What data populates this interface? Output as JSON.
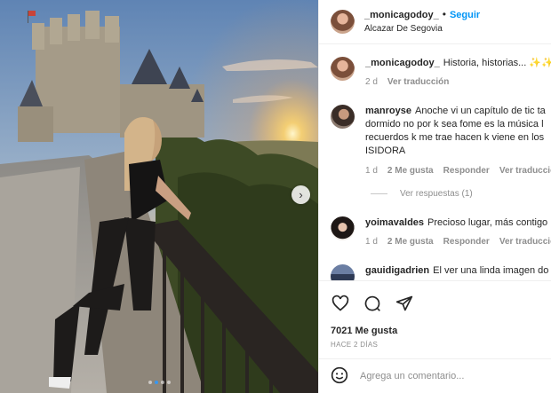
{
  "post": {
    "next_icon": "chevron-right",
    "carousel_dots": 4,
    "carousel_active": 2
  },
  "header": {
    "username": "_monicagodoy_",
    "separator": "•",
    "follow_label": "Seguir",
    "location": "Alcazar De Segovia",
    "more_icon": "ellipsis"
  },
  "caption": {
    "username": "_monicagodoy_",
    "text": "Historia, historias... ✨✨",
    "time": "2 d",
    "translate_label": "Ver traducción"
  },
  "comments": [
    {
      "username": "manroyse",
      "text": "Anoche vi un capítulo de tic ta dormido no por k sea fome es la música l recuerdos k me trae hacen k viene en los ISIDORA",
      "lines": [
        "Anoche vi un capítulo de tic ta",
        "dormido no por k sea fome es la música l",
        "recuerdos k me trae hacen k viene en los",
        "ISIDORA"
      ],
      "time": "1 d",
      "likes": "2 Me gusta",
      "reply_label": "Responder",
      "translate_label": "Ver traducción",
      "view_replies": "Ver respuestas (1)"
    },
    {
      "username": "yoimavaldes",
      "text": "Precioso lugar, más contigo",
      "time": "1 d",
      "likes": "2 Me gusta",
      "reply_label": "Responder",
      "translate_label": "Ver traducción"
    },
    {
      "username": "gauidigadrien",
      "text": "El ver una linda imagen do"
    }
  ],
  "actions": {
    "like_icon": "heart",
    "comment_icon": "speech-bubble",
    "share_icon": "paper-plane",
    "save_icon": "bookmark",
    "likes_count": "7021 Me gusta",
    "posted_ago": "HACE 2 DÍAS"
  },
  "add_comment": {
    "emoji_icon": "smiley",
    "placeholder": "Agrega un comentario..."
  }
}
